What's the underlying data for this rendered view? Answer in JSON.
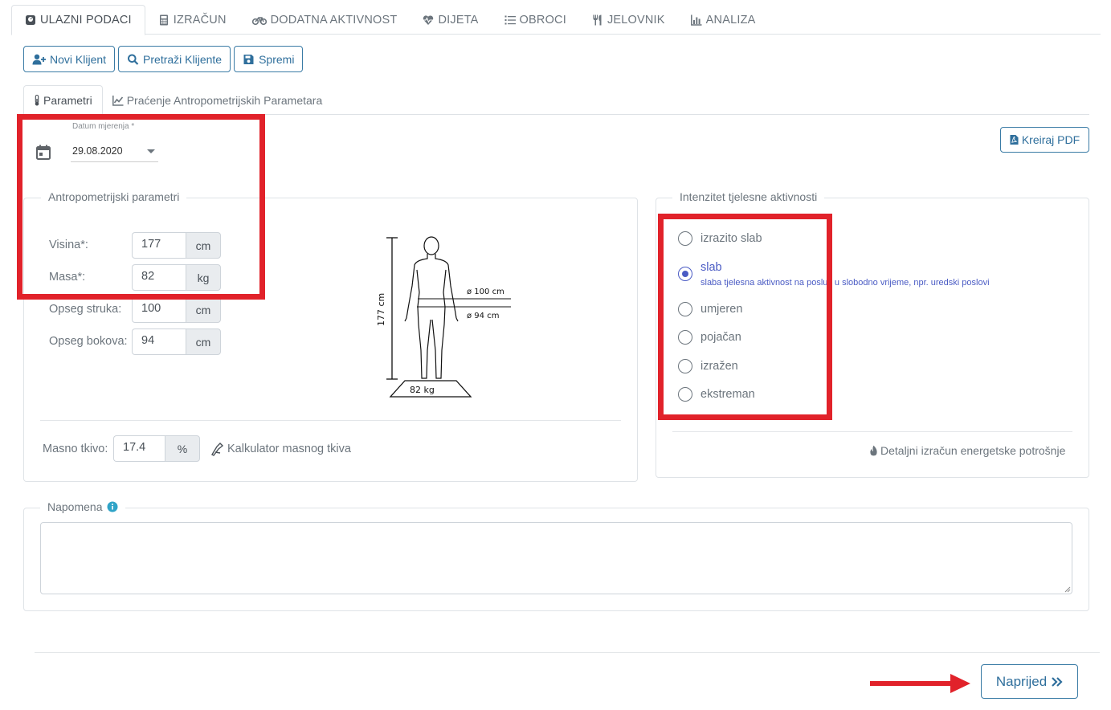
{
  "top_tabs": [
    {
      "label": "ULAZNI PODACI",
      "icon": "scale-icon",
      "active": true
    },
    {
      "label": "IZRAČUN",
      "icon": "calculator-icon",
      "active": false
    },
    {
      "label": "DODATNA AKTIVNOST",
      "icon": "bicycle-icon",
      "active": false
    },
    {
      "label": "DIJETA",
      "icon": "heartbeat-icon",
      "active": false
    },
    {
      "label": "OBROCI",
      "icon": "list-icon",
      "active": false
    },
    {
      "label": "JELOVNIK",
      "icon": "utensils-icon",
      "active": false
    },
    {
      "label": "ANALIZA",
      "icon": "bar-chart-icon",
      "active": false
    }
  ],
  "toolbar": {
    "new_client": "Novi Klijent",
    "search_clients": "Pretraži Klijente",
    "save": "Spremi"
  },
  "sub_tabs": {
    "parameters": "Parametri",
    "tracking": "Praćenje Antropometrijskih Parametara"
  },
  "date": {
    "label": "Datum mjerenja *",
    "value": "29.08.2020"
  },
  "pdf_button": "Kreiraj PDF",
  "anthropometric": {
    "legend": "Antropometrijski parametri",
    "height": {
      "label": "Visina*:",
      "value": "177",
      "unit": "cm"
    },
    "mass": {
      "label": "Masa*:",
      "value": "82",
      "unit": "kg"
    },
    "waist": {
      "label": "Opseg struka:",
      "value": "100",
      "unit": "cm"
    },
    "hips": {
      "label": "Opseg bokova:",
      "value": "94",
      "unit": "cm"
    },
    "figure": {
      "height_label": "177 cm",
      "waist_label": "ø 100 cm",
      "hips_label": "ø 94 cm",
      "weight_label": "82 kg"
    },
    "body_fat": {
      "label": "Masno tkivo:",
      "value": "17.4",
      "unit": "%"
    },
    "fat_calculator": "Kalkulator masnog tkiva"
  },
  "activity": {
    "legend": "Intenzitet tjelesne aktivnosti",
    "options": [
      {
        "label": "izrazito slab",
        "checked": false,
        "description": ""
      },
      {
        "label": "slab",
        "checked": true,
        "description": "slaba tjelesna aktivnost na poslu i u slobodno vrijeme, npr. uredski poslovi"
      },
      {
        "label": "umjeren",
        "checked": false,
        "description": ""
      },
      {
        "label": "pojačan",
        "checked": false,
        "description": ""
      },
      {
        "label": "izražen",
        "checked": false,
        "description": ""
      },
      {
        "label": "ekstreman",
        "checked": false,
        "description": ""
      }
    ],
    "energy_link": "Detaljni izračun energetske potrošnje"
  },
  "note": {
    "legend": "Napomena",
    "value": ""
  },
  "next_button": "Naprijed",
  "colors": {
    "accent": "#2f6f9c",
    "radio_checked": "#4a5bc4",
    "annotation_red": "#e1222a"
  }
}
